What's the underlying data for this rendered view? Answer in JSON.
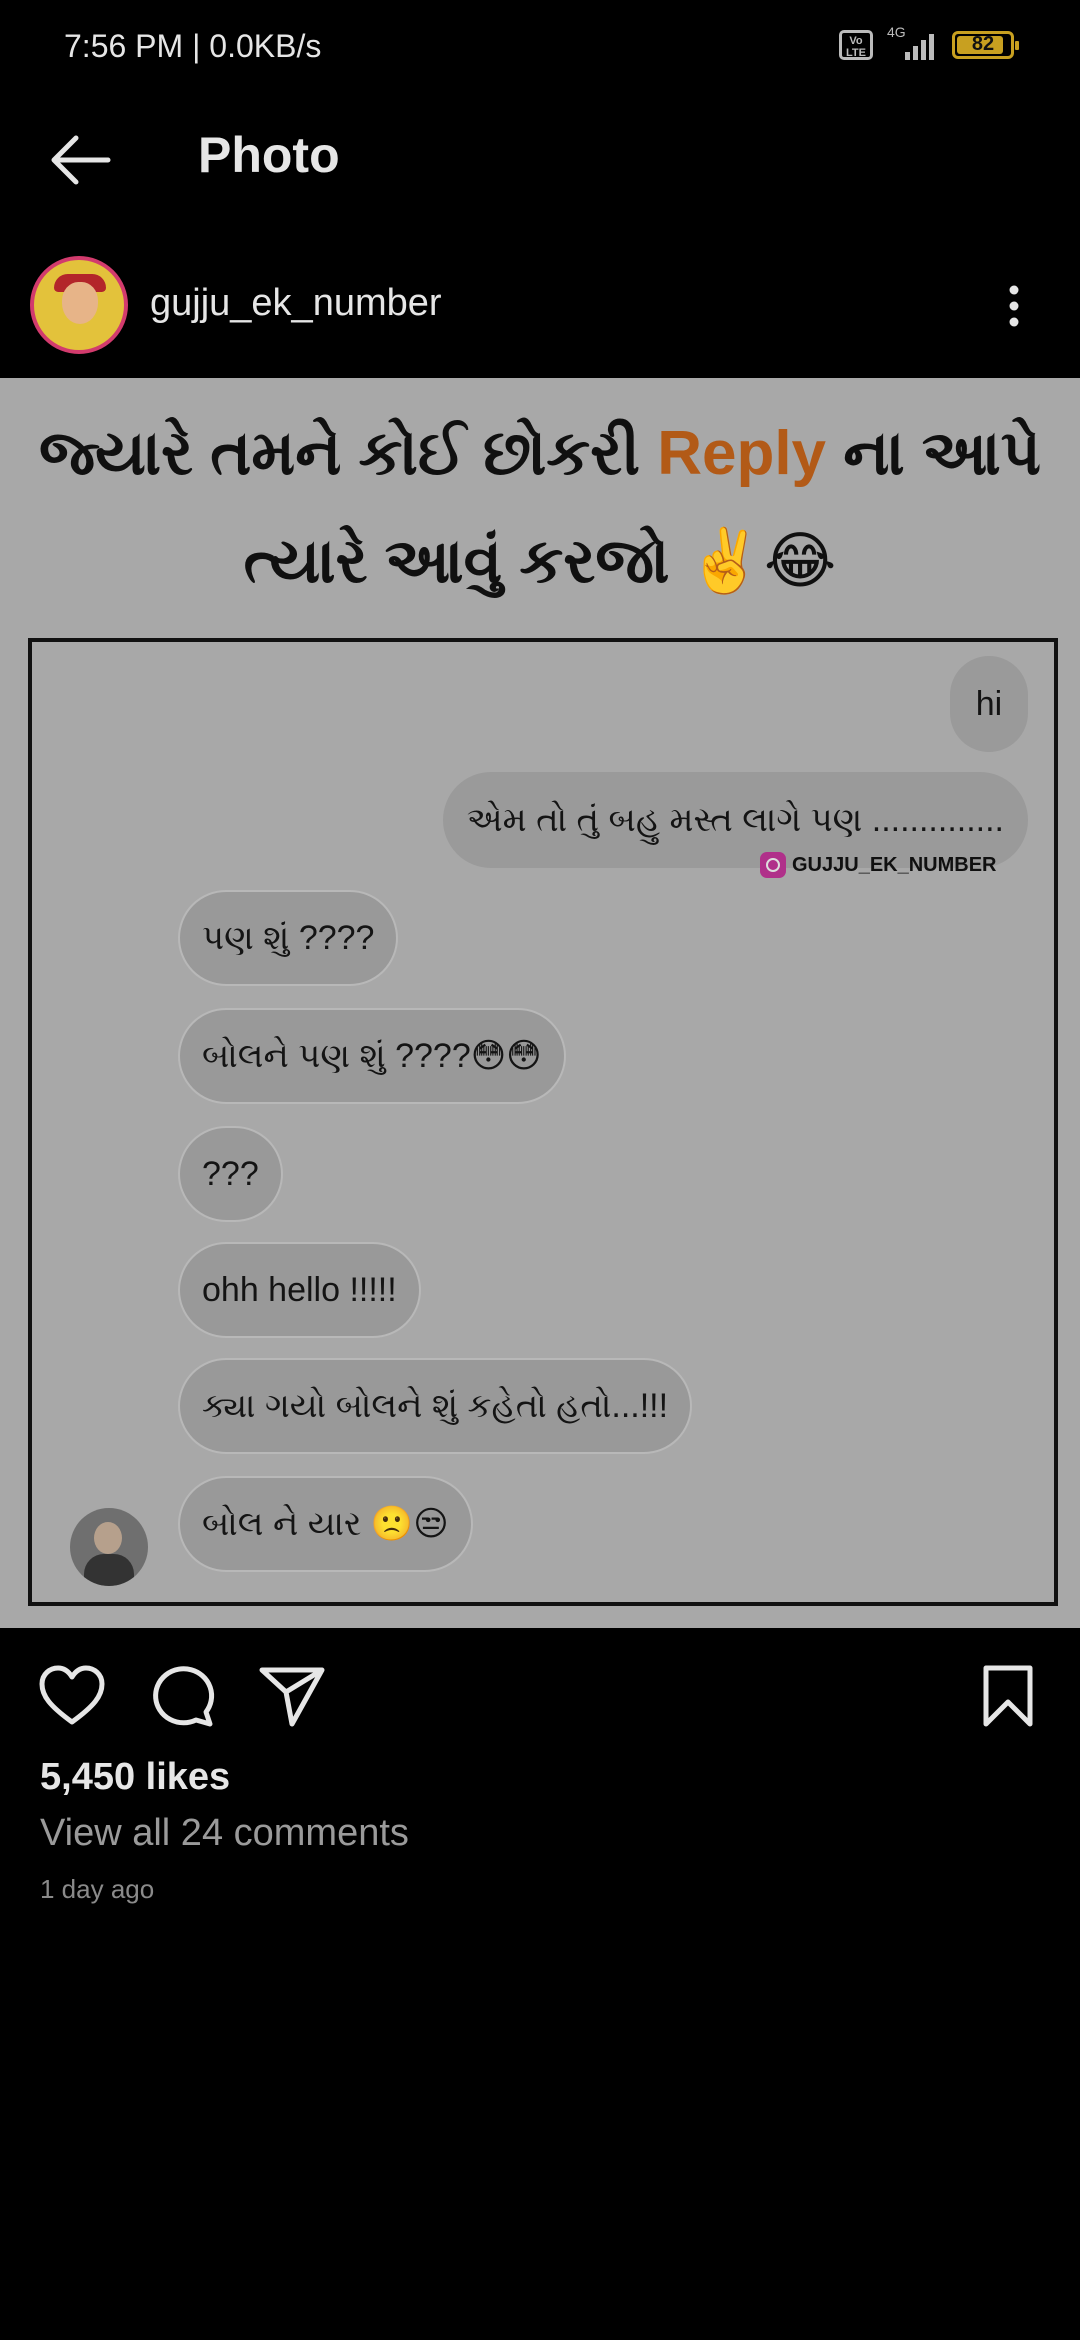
{
  "status_bar": {
    "time_speed": "7:56 PM | 0.0KB/s",
    "volte": "Vo LTE",
    "network": "4G",
    "battery": "82",
    "battery_level": 0.82
  },
  "header": {
    "title": "Photo",
    "back_icon": "back-arrow-icon"
  },
  "post": {
    "username": "gujju_ek_number",
    "more_icon": "more-vertical-icon",
    "avatar_label": "Gujju EK NUMBER",
    "image": {
      "headline_line1_part1": "જ્યારે તમને કોઈ છોકરી ",
      "headline_line1_accent": "Reply",
      "headline_line1_part2": " ના આપે",
      "headline_line2": "ત્યારે આવું કરજો ✌️😂",
      "accent_color": "#b25a17",
      "watermark": "GUJJU_EK_NUMBER",
      "messages": [
        {
          "text": "hi",
          "side": "sent"
        },
        {
          "text": "એમ તો તું બહુ મસ્ત લાગે પણ ..............",
          "side": "sent"
        },
        {
          "text": "પણ શું ????",
          "side": "received"
        },
        {
          "text": "બોલને પણ શું ????😳😳",
          "side": "received"
        },
        {
          "text": "???",
          "side": "received"
        },
        {
          "text": "ohh hello !!!!!",
          "side": "received"
        },
        {
          "text": "ક્યા ગયો બોલને શું કહેતો હતો...!!!",
          "side": "received"
        },
        {
          "text": "બોલ ને યાર 🙁😒",
          "side": "received"
        }
      ]
    },
    "actions": {
      "like_icon": "heart-icon",
      "comment_icon": "comment-icon",
      "share_icon": "send-icon",
      "save_icon": "bookmark-icon"
    },
    "likes": "5,450 likes",
    "comments_link": "View all 24 comments",
    "timestamp": "1 day ago"
  }
}
